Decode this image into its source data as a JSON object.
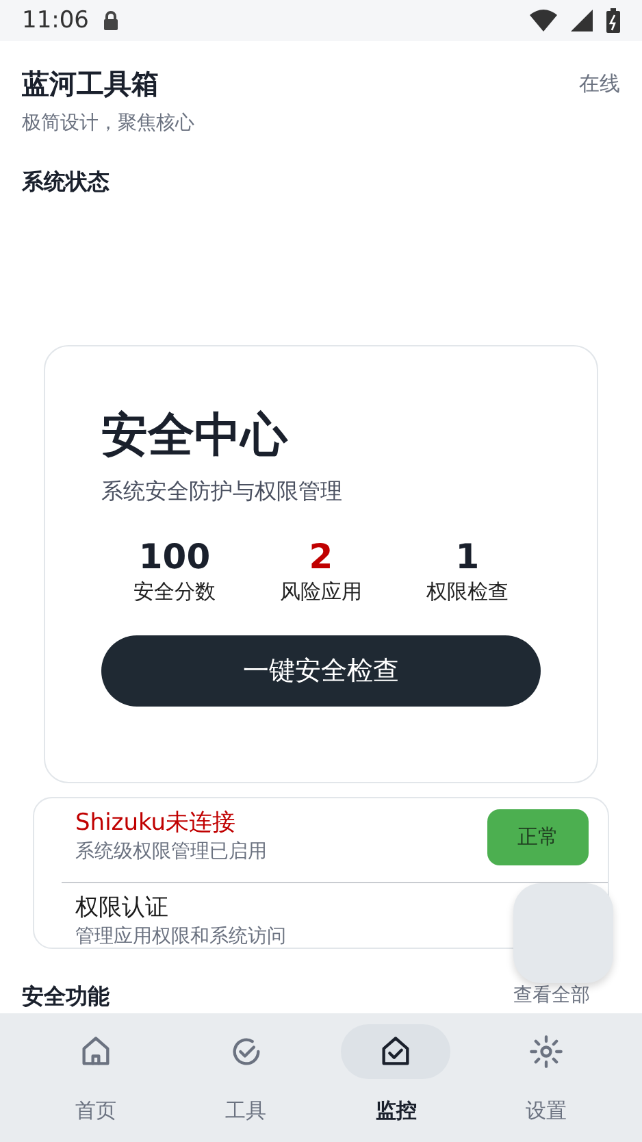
{
  "status_bar": {
    "time": "11:06"
  },
  "header": {
    "title": "蓝河工具箱",
    "subtitle": "极简设计，聚焦核心",
    "status": "在线"
  },
  "section_title": "系统状态",
  "security_card": {
    "title": "安全中心",
    "subtitle": "系统安全防护与权限管理",
    "stats": [
      {
        "value": "100",
        "label": "安全分数",
        "color": "#1a202c"
      },
      {
        "value": "2",
        "label": "风险应用",
        "color": "#c00000"
      },
      {
        "value": "1",
        "label": "权限检查",
        "color": "#1a202c"
      }
    ],
    "button": "一键安全检查"
  },
  "status_list": [
    {
      "title": "Shizuku未连接",
      "subtitle": "系统级权限管理已启用",
      "color": "#c00000",
      "badge": "正常"
    },
    {
      "title": "权限认证",
      "subtitle": "管理应用权限和系统访问",
      "color": "#1a1a1a"
    }
  ],
  "next_section": {
    "title": "安全功能",
    "link": "查看全部"
  },
  "nav": [
    {
      "label": "首页",
      "selected": false
    },
    {
      "label": "工具",
      "selected": false
    },
    {
      "label": "监控",
      "selected": true
    },
    {
      "label": "设置",
      "selected": false
    }
  ]
}
